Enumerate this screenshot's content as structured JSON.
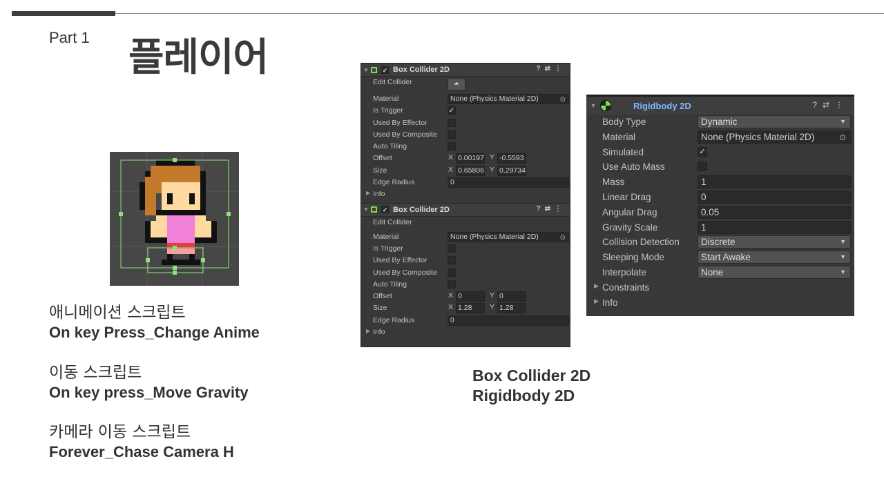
{
  "slide": {
    "part": "Part 1",
    "title": "플레이어"
  },
  "scripts": [
    {
      "ko": "애니메이션 스크립트",
      "en": "On key Press_Change Anime"
    },
    {
      "ko": "이동 스크립트",
      "en": "On key press_Move Gravity"
    },
    {
      "ko": "카메라 이동 스크립트",
      "en": "Forever_Chase Camera H"
    }
  ],
  "caption": {
    "line1": "Box Collider 2D",
    "line2": "Rigidbody 2D"
  },
  "box_colliders": [
    {
      "title": "Box Collider 2D",
      "edit_collider": "Edit Collider",
      "material_label": "Material",
      "material_value": "None (Physics Material 2D)",
      "is_trigger_label": "Is Trigger",
      "is_trigger": "✓",
      "used_by_effector": "Used By Effector",
      "used_by_composite": "Used By Composite",
      "auto_tiling": "Auto Tiling",
      "offset_label": "Offset",
      "offset_x": "0.00197",
      "offset_y": "-0.5593",
      "size_label": "Size",
      "size_x": "0.65806",
      "size_y": "0.29734",
      "edge_radius_label": "Edge Radius",
      "edge_radius": "0",
      "info": "Info",
      "x": "X",
      "y": "Y"
    },
    {
      "title": "Box Collider 2D",
      "edit_collider": "Edit Collider",
      "material_label": "Material",
      "material_value": "None (Physics Material 2D)",
      "is_trigger_label": "Is Trigger",
      "is_trigger": "",
      "used_by_effector": "Used By Effector",
      "used_by_composite": "Used By Composite",
      "auto_tiling": "Auto Tiling",
      "offset_label": "Offset",
      "offset_x": "0",
      "offset_y": "0",
      "size_label": "Size",
      "size_x": "1.28",
      "size_y": "1.28",
      "edge_radius_label": "Edge Radius",
      "edge_radius": "0",
      "info": "Info",
      "x": "X",
      "y": "Y"
    }
  ],
  "rigidbody": {
    "title": "Rigidbody 2D",
    "body_type_label": "Body Type",
    "body_type": "Dynamic",
    "material_label": "Material",
    "material_value": "None (Physics Material 2D)",
    "simulated_label": "Simulated",
    "simulated": "✓",
    "use_auto_mass_label": "Use Auto Mass",
    "mass_label": "Mass",
    "mass": "1",
    "linear_drag_label": "Linear Drag",
    "linear_drag": "0",
    "angular_drag_label": "Angular Drag",
    "angular_drag": "0.05",
    "gravity_scale_label": "Gravity Scale",
    "gravity_scale": "1",
    "collision_detection_label": "Collision Detection",
    "collision_detection": "Discrete",
    "sleeping_mode_label": "Sleeping Mode",
    "sleeping_mode": "Start Awake",
    "interpolate_label": "Interpolate",
    "interpolate": "None",
    "constraints_label": "Constraints",
    "info_label": "Info"
  },
  "icons": {
    "help": "?",
    "settings": "⇄",
    "more": "⋮",
    "dropdown": "▼",
    "fold": "▶",
    "object_picker": "⊙",
    "edit_collider": "⏶"
  },
  "colors": {
    "inspector_bg": "#383838",
    "rigidbody_title": "#7fb8ff",
    "collider_green": "#7ede4a",
    "sprite_hair": "#c47a2b",
    "sprite_skin": "#ffd9a0",
    "sprite_dress": "#f080d8"
  }
}
